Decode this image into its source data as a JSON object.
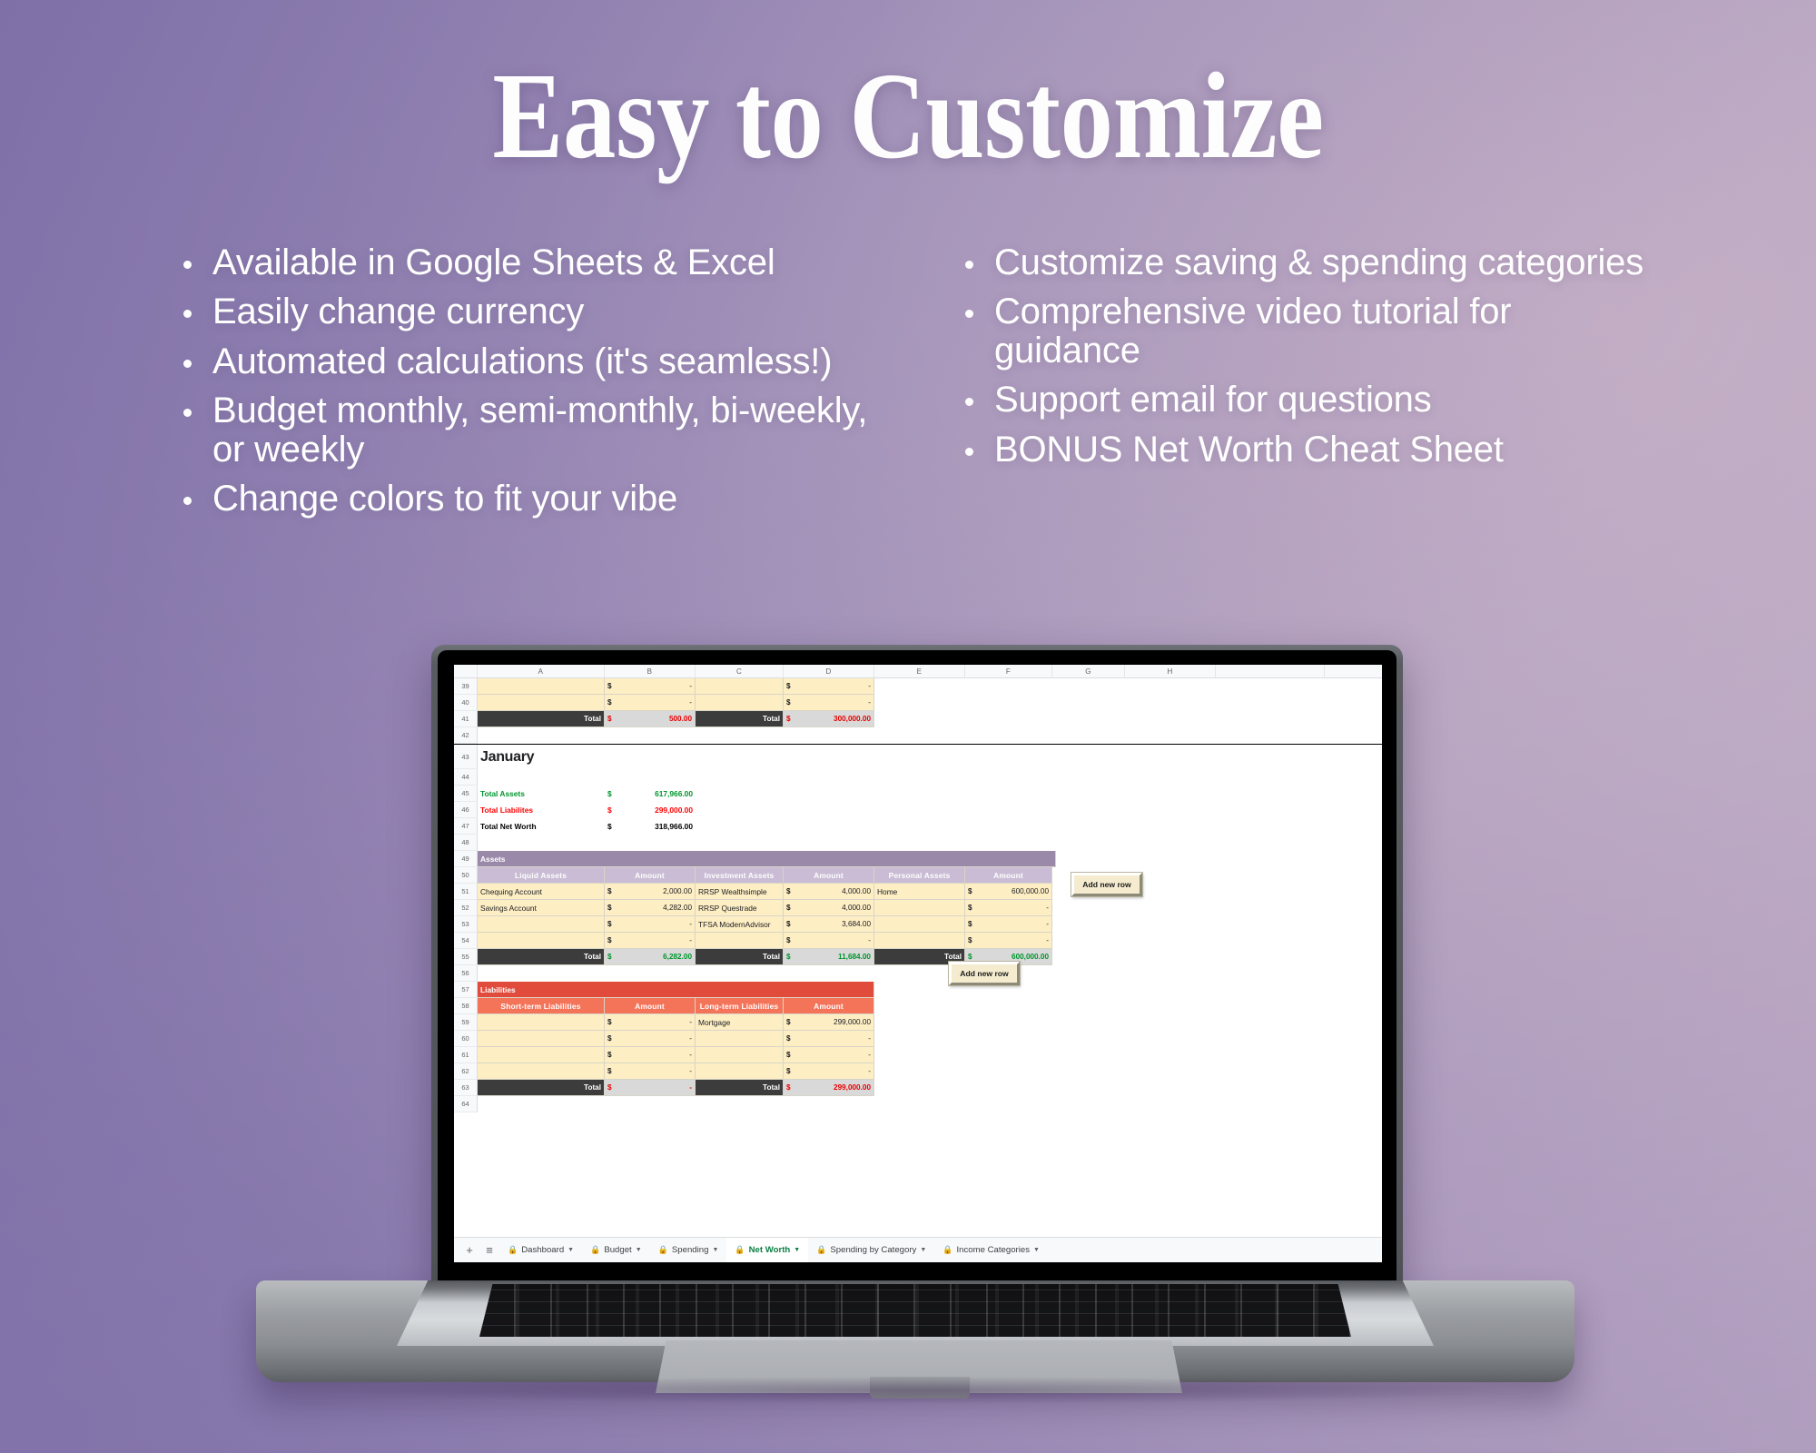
{
  "headline": "Easy to Customize",
  "bullets": {
    "left": [
      "Available in Google Sheets & Excel",
      "Easily change currency",
      "Automated calculations (it's seamless!)",
      "Budget monthly, semi-monthly, bi-weekly, or weekly",
      "Change colors to fit your vibe"
    ],
    "right": [
      "Customize saving & spending categories",
      "Comprehensive video tutorial for guidance",
      "Support email for questions",
      "BONUS Net Worth Cheat Sheet"
    ]
  },
  "spreadsheet": {
    "column_headers": [
      "A",
      "B",
      "C",
      "D",
      "E",
      "F",
      "G",
      "H"
    ],
    "row_numbers": [
      "39",
      "40",
      "41",
      "42",
      "43",
      "44",
      "45",
      "46",
      "47",
      "48",
      "49",
      "50",
      "51",
      "52",
      "53",
      "54",
      "55",
      "56",
      "57",
      "58",
      "59",
      "60",
      "61",
      "62",
      "63",
      "64"
    ],
    "top_table": {
      "rows": [
        {
          "rn": "39",
          "a": "",
          "b_cur": "$",
          "b_val": "-",
          "c": "",
          "d_cur": "$",
          "d_val": "-"
        },
        {
          "rn": "40",
          "a": "",
          "b_cur": "$",
          "b_val": "-",
          "c": "",
          "d_cur": "$",
          "d_val": "-"
        }
      ],
      "total_row": {
        "rn": "41",
        "label_left": "Total",
        "left_cur": "$",
        "left_val": "500.00",
        "label_right": "Total",
        "right_cur": "$",
        "right_val": "300,000.00"
      }
    },
    "month_title": "January",
    "summary": [
      {
        "rn": "45",
        "label": "Total Assets",
        "cur": "$",
        "value": "617,966.00",
        "style": "green"
      },
      {
        "rn": "46",
        "label": "Total Liabilites",
        "cur": "$",
        "value": "299,000.00",
        "style": "red"
      },
      {
        "rn": "47",
        "label": "Total Net Worth",
        "cur": "$",
        "value": "318,966.00",
        "style": "black"
      }
    ],
    "assets": {
      "section_title": "Assets",
      "headers": [
        "Liquid Assets",
        "Amount",
        "Investment Assets",
        "Amount",
        "Personal Assets",
        "Amount"
      ],
      "rows": [
        {
          "rn": "51",
          "liquid": "Chequing Account",
          "liquid_cur": "$",
          "liquid_amt": "2,000.00",
          "invest": "RRSP Wealthsimple",
          "invest_cur": "$",
          "invest_amt": "4,000.00",
          "personal": "Home",
          "personal_cur": "$",
          "personal_amt": "600,000.00"
        },
        {
          "rn": "52",
          "liquid": "Savings Account",
          "liquid_cur": "$",
          "liquid_amt": "4,282.00",
          "invest": "RRSP Questrade",
          "invest_cur": "$",
          "invest_amt": "4,000.00",
          "personal": "",
          "personal_cur": "$",
          "personal_amt": "-"
        },
        {
          "rn": "53",
          "liquid": "",
          "liquid_cur": "$",
          "liquid_amt": "-",
          "invest": "TFSA ModernAdvisor",
          "invest_cur": "$",
          "invest_amt": "3,684.00",
          "personal": "",
          "personal_cur": "$",
          "personal_amt": "-"
        },
        {
          "rn": "54",
          "liquid": "",
          "liquid_cur": "$",
          "liquid_amt": "-",
          "invest": "",
          "invest_cur": "$",
          "invest_amt": "-",
          "personal": "",
          "personal_cur": "$",
          "personal_amt": "-"
        }
      ],
      "totals": {
        "rn": "55",
        "label": "Total",
        "liquid_cur": "$",
        "liquid_total": "6,282.00",
        "invest_cur": "$",
        "invest_total": "11,684.00",
        "personal_cur": "$",
        "personal_total": "600,000.00"
      },
      "add_row_button": "Add new row"
    },
    "liabilities": {
      "section_title": "Liabilities",
      "headers": [
        "Short-term Liabilities",
        "Amount",
        "Long-term Liabilities",
        "Amount"
      ],
      "rows": [
        {
          "rn": "59",
          "short": "",
          "short_cur": "$",
          "short_amt": "-",
          "long": "Mortgage",
          "long_cur": "$",
          "long_amt": "299,000.00"
        },
        {
          "rn": "60",
          "short": "",
          "short_cur": "$",
          "short_amt": "-",
          "long": "",
          "long_cur": "$",
          "long_amt": "-"
        },
        {
          "rn": "61",
          "short": "",
          "short_cur": "$",
          "short_amt": "-",
          "long": "",
          "long_cur": "$",
          "long_amt": "-"
        },
        {
          "rn": "62",
          "short": "",
          "short_cur": "$",
          "short_amt": "-",
          "long": "",
          "long_cur": "$",
          "long_amt": "-"
        }
      ],
      "totals": {
        "rn": "63",
        "label": "Total",
        "short_cur": "$",
        "short_total": "-",
        "long_cur": "$",
        "long_total": "299,000.00"
      },
      "add_row_button": "Add new row"
    },
    "sheet_tabs": {
      "add_label": "+",
      "all_sheets_label": "≡",
      "tabs": [
        {
          "label": "Dashboard",
          "active": false
        },
        {
          "label": "Budget",
          "active": false
        },
        {
          "label": "Spending",
          "active": false
        },
        {
          "label": "Net Worth",
          "active": true
        },
        {
          "label": "Spending by Category",
          "active": false
        },
        {
          "label": "Income Categories",
          "active": false
        }
      ]
    }
  },
  "colors": {
    "assets_section": "#9b89aa",
    "assets_header": "#c9bcd4",
    "liabilities_section": "#e04b3c",
    "liabilities_header": "#f4745a",
    "cream_cell": "#fdeec4",
    "total_dark": "#3c3c3c",
    "positive_green": "#00962d",
    "negative_red": "#ea0000",
    "active_tab_green": "#0a8043"
  }
}
